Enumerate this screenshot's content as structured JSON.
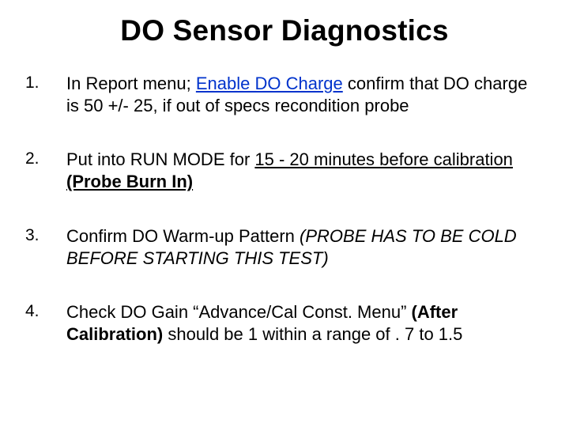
{
  "title": "DO Sensor Diagnostics",
  "steps": {
    "1": {
      "num": "1.",
      "pre": "In Report menu; ",
      "action": "Enable DO Charge",
      "post": " confirm that DO charge is 50 +/- 25, if out of specs recondition probe"
    },
    "2": {
      "num": "2.",
      "pre": "Put into RUN MODE for ",
      "timing": "15 - 20 minutes  before calibration ",
      "label": "(Probe Burn In)"
    },
    "3": {
      "num": "3.",
      "lead": "Confirm DO Warm-up Pattern ",
      "note": "(PROBE HAS TO BE COLD BEFORE STARTING THIS TEST)"
    },
    "4": {
      "num": "4.",
      "a": "Check DO Gain “Advance/Cal Const. Menu” ",
      "b": "(After Calibration)",
      "c": " should be 1 within a range of . 7 to 1.5"
    }
  }
}
